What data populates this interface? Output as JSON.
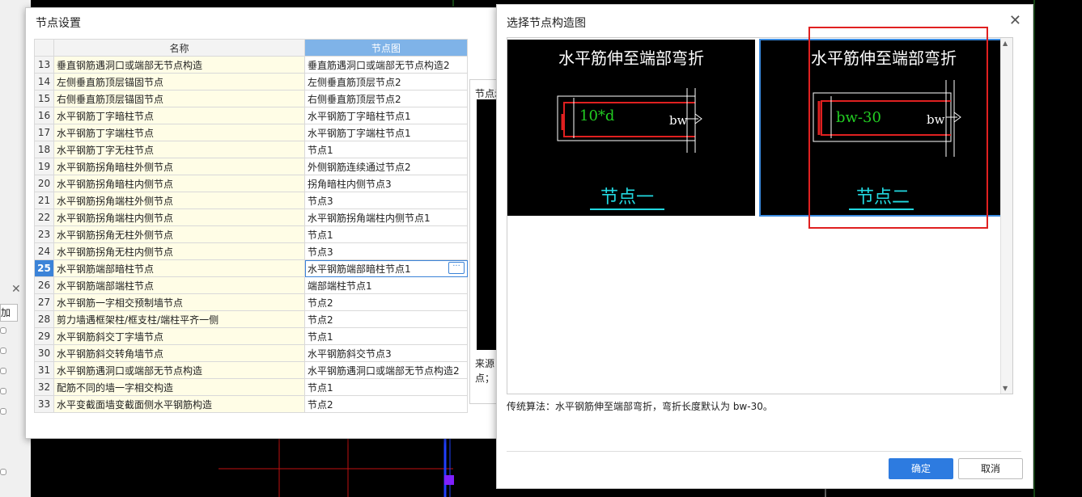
{
  "background": {
    "left_panel": {
      "close_glyph": "✕",
      "add_label": "加"
    }
  },
  "node_settings": {
    "title": "节点设置",
    "columns": {
      "name": "名称",
      "diagram": "节点图"
    },
    "rows": [
      {
        "idx": "13",
        "name": "垂直钢筋遇洞口或端部无节点构造",
        "diagram": "垂直筋遇洞口或端部无节点构造2"
      },
      {
        "idx": "14",
        "name": "左侧垂直筋顶层锚固节点",
        "diagram": "左侧垂直筋顶层节点2"
      },
      {
        "idx": "15",
        "name": "右侧垂直筋顶层锚固节点",
        "diagram": "右侧垂直筋顶层节点2"
      },
      {
        "idx": "16",
        "name": "水平钢筋丁字暗柱节点",
        "diagram": "水平钢筋丁字暗柱节点1"
      },
      {
        "idx": "17",
        "name": "水平钢筋丁字端柱节点",
        "diagram": "水平钢筋丁字端柱节点1"
      },
      {
        "idx": "18",
        "name": "水平钢筋丁字无柱节点",
        "diagram": "节点1"
      },
      {
        "idx": "19",
        "name": "水平钢筋拐角暗柱外侧节点",
        "diagram": "外侧钢筋连续通过节点2"
      },
      {
        "idx": "20",
        "name": "水平钢筋拐角暗柱内侧节点",
        "diagram": "拐角暗柱内侧节点3"
      },
      {
        "idx": "21",
        "name": "水平钢筋拐角端柱外侧节点",
        "diagram": "节点3"
      },
      {
        "idx": "22",
        "name": "水平钢筋拐角端柱内侧节点",
        "diagram": "水平钢筋拐角端柱内侧节点1"
      },
      {
        "idx": "23",
        "name": "水平钢筋拐角无柱外侧节点",
        "diagram": "节点1"
      },
      {
        "idx": "24",
        "name": "水平钢筋拐角无柱内侧节点",
        "diagram": "节点3"
      },
      {
        "idx": "25",
        "name": "水平钢筋端部暗柱节点",
        "diagram": "水平钢筋端部暗柱节点1"
      },
      {
        "idx": "26",
        "name": "水平钢筋端部端柱节点",
        "diagram": "端部端柱节点1"
      },
      {
        "idx": "27",
        "name": "水平钢筋一字相交预制墙节点",
        "diagram": "节点2"
      },
      {
        "idx": "28",
        "name": "剪力墙遇框架柱/框支柱/端柱平齐一侧",
        "diagram": "节点2"
      },
      {
        "idx": "29",
        "name": "水平钢筋斜交丁字墙节点",
        "diagram": "节点1"
      },
      {
        "idx": "30",
        "name": "水平钢筋斜交转角墙节点",
        "diagram": "水平钢筋斜交节点3"
      },
      {
        "idx": "31",
        "name": "水平钢筋遇洞口或端部无节点构造",
        "diagram": "水平钢筋遇洞口或端部无节点构造2"
      },
      {
        "idx": "32",
        "name": "配筋不同的墙一字相交构造",
        "diagram": "节点1"
      },
      {
        "idx": "33",
        "name": "水平变截面墙变截面侧水平钢筋构造",
        "diagram": "节点2"
      }
    ],
    "ellipsis_label": "···",
    "preview": {
      "label": "节点示",
      "source_line1": "来源",
      "source_line2": "点；"
    }
  },
  "choose_diagram": {
    "title": "选择节点构造图",
    "close_glyph": "✕",
    "cards": [
      {
        "heading": "水平筋伸至端部弯折",
        "dim": "10*d",
        "bw": "bw",
        "caption": "节点一"
      },
      {
        "heading": "水平筋伸至端部弯折",
        "dim": "bw-30",
        "bw": "bw",
        "caption": "节点二"
      }
    ],
    "description": "传统算法：水平钢筋伸至端部弯折，弯折长度默认为 bw-30。",
    "ok_label": "确定",
    "cancel_label": "取消",
    "scroll_up": "▲",
    "scroll_down": "▼"
  },
  "colors": {
    "selection_blue": "#3b83d8",
    "highlight_red": "#e02020",
    "cad_cyan": "#22d8e0",
    "cad_green": "#22cc22",
    "cad_red": "#e02020"
  }
}
